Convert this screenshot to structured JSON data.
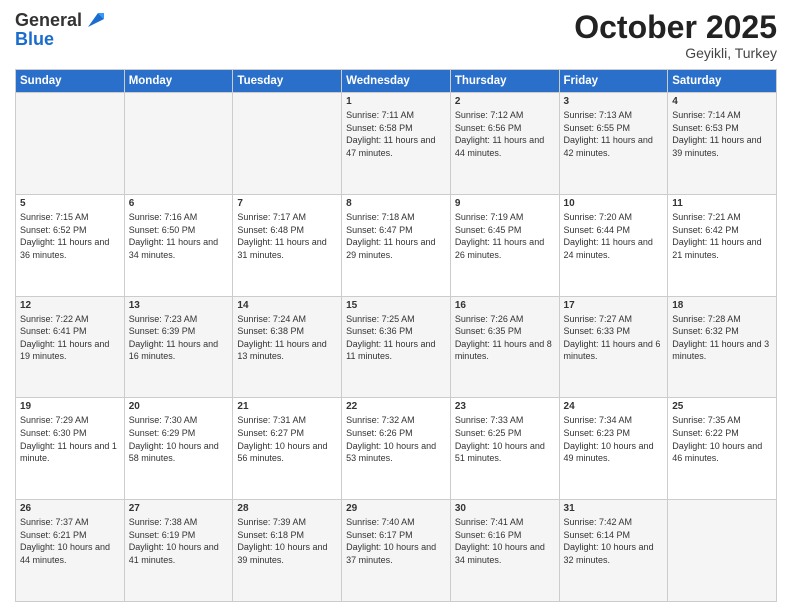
{
  "header": {
    "logo_line1": "General",
    "logo_line2": "Blue",
    "month": "October 2025",
    "location": "Geyikli, Turkey"
  },
  "days_of_week": [
    "Sunday",
    "Monday",
    "Tuesday",
    "Wednesday",
    "Thursday",
    "Friday",
    "Saturday"
  ],
  "weeks": [
    [
      {
        "day": "",
        "sunrise": "",
        "sunset": "",
        "daylight": ""
      },
      {
        "day": "",
        "sunrise": "",
        "sunset": "",
        "daylight": ""
      },
      {
        "day": "",
        "sunrise": "",
        "sunset": "",
        "daylight": ""
      },
      {
        "day": "1",
        "sunrise": "Sunrise: 7:11 AM",
        "sunset": "Sunset: 6:58 PM",
        "daylight": "Daylight: 11 hours and 47 minutes."
      },
      {
        "day": "2",
        "sunrise": "Sunrise: 7:12 AM",
        "sunset": "Sunset: 6:56 PM",
        "daylight": "Daylight: 11 hours and 44 minutes."
      },
      {
        "day": "3",
        "sunrise": "Sunrise: 7:13 AM",
        "sunset": "Sunset: 6:55 PM",
        "daylight": "Daylight: 11 hours and 42 minutes."
      },
      {
        "day": "4",
        "sunrise": "Sunrise: 7:14 AM",
        "sunset": "Sunset: 6:53 PM",
        "daylight": "Daylight: 11 hours and 39 minutes."
      }
    ],
    [
      {
        "day": "5",
        "sunrise": "Sunrise: 7:15 AM",
        "sunset": "Sunset: 6:52 PM",
        "daylight": "Daylight: 11 hours and 36 minutes."
      },
      {
        "day": "6",
        "sunrise": "Sunrise: 7:16 AM",
        "sunset": "Sunset: 6:50 PM",
        "daylight": "Daylight: 11 hours and 34 minutes."
      },
      {
        "day": "7",
        "sunrise": "Sunrise: 7:17 AM",
        "sunset": "Sunset: 6:48 PM",
        "daylight": "Daylight: 11 hours and 31 minutes."
      },
      {
        "day": "8",
        "sunrise": "Sunrise: 7:18 AM",
        "sunset": "Sunset: 6:47 PM",
        "daylight": "Daylight: 11 hours and 29 minutes."
      },
      {
        "day": "9",
        "sunrise": "Sunrise: 7:19 AM",
        "sunset": "Sunset: 6:45 PM",
        "daylight": "Daylight: 11 hours and 26 minutes."
      },
      {
        "day": "10",
        "sunrise": "Sunrise: 7:20 AM",
        "sunset": "Sunset: 6:44 PM",
        "daylight": "Daylight: 11 hours and 24 minutes."
      },
      {
        "day": "11",
        "sunrise": "Sunrise: 7:21 AM",
        "sunset": "Sunset: 6:42 PM",
        "daylight": "Daylight: 11 hours and 21 minutes."
      }
    ],
    [
      {
        "day": "12",
        "sunrise": "Sunrise: 7:22 AM",
        "sunset": "Sunset: 6:41 PM",
        "daylight": "Daylight: 11 hours and 19 minutes."
      },
      {
        "day": "13",
        "sunrise": "Sunrise: 7:23 AM",
        "sunset": "Sunset: 6:39 PM",
        "daylight": "Daylight: 11 hours and 16 minutes."
      },
      {
        "day": "14",
        "sunrise": "Sunrise: 7:24 AM",
        "sunset": "Sunset: 6:38 PM",
        "daylight": "Daylight: 11 hours and 13 minutes."
      },
      {
        "day": "15",
        "sunrise": "Sunrise: 7:25 AM",
        "sunset": "Sunset: 6:36 PM",
        "daylight": "Daylight: 11 hours and 11 minutes."
      },
      {
        "day": "16",
        "sunrise": "Sunrise: 7:26 AM",
        "sunset": "Sunset: 6:35 PM",
        "daylight": "Daylight: 11 hours and 8 minutes."
      },
      {
        "day": "17",
        "sunrise": "Sunrise: 7:27 AM",
        "sunset": "Sunset: 6:33 PM",
        "daylight": "Daylight: 11 hours and 6 minutes."
      },
      {
        "day": "18",
        "sunrise": "Sunrise: 7:28 AM",
        "sunset": "Sunset: 6:32 PM",
        "daylight": "Daylight: 11 hours and 3 minutes."
      }
    ],
    [
      {
        "day": "19",
        "sunrise": "Sunrise: 7:29 AM",
        "sunset": "Sunset: 6:30 PM",
        "daylight": "Daylight: 11 hours and 1 minute."
      },
      {
        "day": "20",
        "sunrise": "Sunrise: 7:30 AM",
        "sunset": "Sunset: 6:29 PM",
        "daylight": "Daylight: 10 hours and 58 minutes."
      },
      {
        "day": "21",
        "sunrise": "Sunrise: 7:31 AM",
        "sunset": "Sunset: 6:27 PM",
        "daylight": "Daylight: 10 hours and 56 minutes."
      },
      {
        "day": "22",
        "sunrise": "Sunrise: 7:32 AM",
        "sunset": "Sunset: 6:26 PM",
        "daylight": "Daylight: 10 hours and 53 minutes."
      },
      {
        "day": "23",
        "sunrise": "Sunrise: 7:33 AM",
        "sunset": "Sunset: 6:25 PM",
        "daylight": "Daylight: 10 hours and 51 minutes."
      },
      {
        "day": "24",
        "sunrise": "Sunrise: 7:34 AM",
        "sunset": "Sunset: 6:23 PM",
        "daylight": "Daylight: 10 hours and 49 minutes."
      },
      {
        "day": "25",
        "sunrise": "Sunrise: 7:35 AM",
        "sunset": "Sunset: 6:22 PM",
        "daylight": "Daylight: 10 hours and 46 minutes."
      }
    ],
    [
      {
        "day": "26",
        "sunrise": "Sunrise: 7:37 AM",
        "sunset": "Sunset: 6:21 PM",
        "daylight": "Daylight: 10 hours and 44 minutes."
      },
      {
        "day": "27",
        "sunrise": "Sunrise: 7:38 AM",
        "sunset": "Sunset: 6:19 PM",
        "daylight": "Daylight: 10 hours and 41 minutes."
      },
      {
        "day": "28",
        "sunrise": "Sunrise: 7:39 AM",
        "sunset": "Sunset: 6:18 PM",
        "daylight": "Daylight: 10 hours and 39 minutes."
      },
      {
        "day": "29",
        "sunrise": "Sunrise: 7:40 AM",
        "sunset": "Sunset: 6:17 PM",
        "daylight": "Daylight: 10 hours and 37 minutes."
      },
      {
        "day": "30",
        "sunrise": "Sunrise: 7:41 AM",
        "sunset": "Sunset: 6:16 PM",
        "daylight": "Daylight: 10 hours and 34 minutes."
      },
      {
        "day": "31",
        "sunrise": "Sunrise: 7:42 AM",
        "sunset": "Sunset: 6:14 PM",
        "daylight": "Daylight: 10 hours and 32 minutes."
      },
      {
        "day": "",
        "sunrise": "",
        "sunset": "",
        "daylight": ""
      }
    ]
  ]
}
